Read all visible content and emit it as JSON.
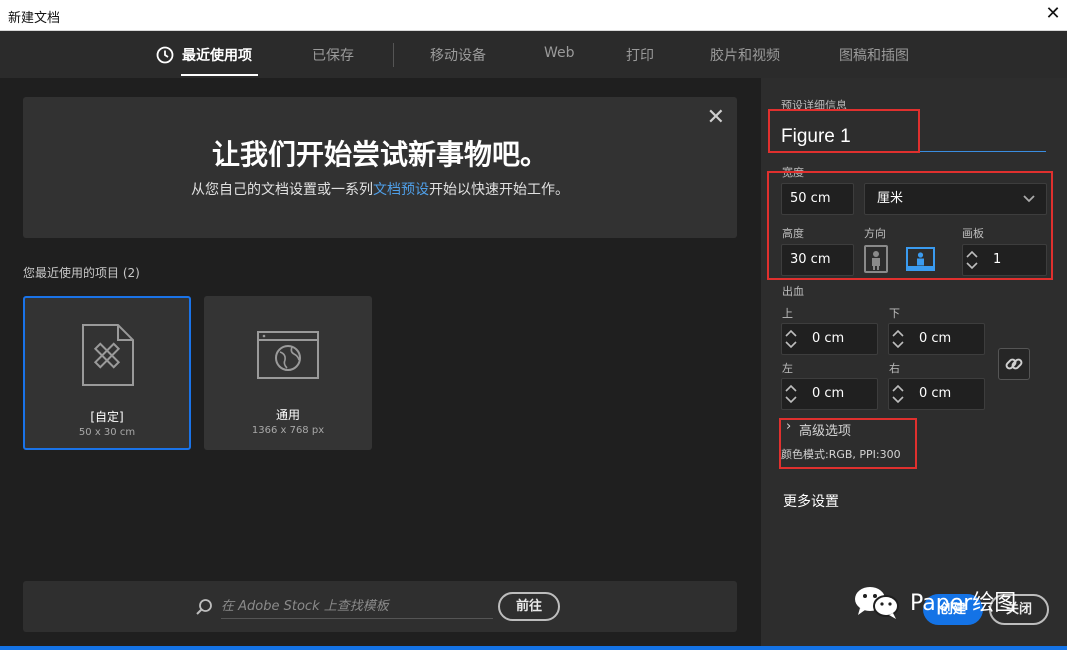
{
  "window": {
    "title": "新建文档",
    "close": "✕"
  },
  "tabs": [
    {
      "label": "最近使用项",
      "active": true
    },
    {
      "label": "已保存"
    },
    {
      "label": "移动设备"
    },
    {
      "label": "Web"
    },
    {
      "label": "打印"
    },
    {
      "label": "胶片和视频"
    },
    {
      "label": "图稿和插图"
    }
  ],
  "welcome": {
    "close": "✕",
    "heading": "让我们开始尝试新事物吧。",
    "sub_before": "从您自己的文档设置或一系列",
    "sub_link": "文档预设",
    "sub_after": "开始以快速开始工作。"
  },
  "recent": {
    "label": "您最近使用的项目",
    "count": "(2)",
    "items": [
      {
        "name": "[自定]",
        "dims": "50 x 30 cm",
        "icon": "document-ruler-pencil-icon",
        "selected": true
      },
      {
        "name": "通用",
        "dims": "1366 x 768 px",
        "icon": "web-globe-icon"
      }
    ]
  },
  "search": {
    "placeholder": "在 Adobe Stock 上查找模板",
    "go": "前往"
  },
  "preset": {
    "section_label": "预设详细信息",
    "name": "Figure 1",
    "width_label": "宽度",
    "width": "50 cm",
    "unit": "厘米",
    "height_label": "高度",
    "height": "30 cm",
    "orientation_label": "方向",
    "orientation": "landscape",
    "artboard_label": "画板",
    "artboards": "1",
    "bleed_label": "出血",
    "bleed": {
      "top_label": "上",
      "top": "0 cm",
      "bottom_label": "下",
      "bottom": "0 cm",
      "left_label": "左",
      "left": "0 cm",
      "right_label": "右",
      "right": "0 cm"
    },
    "advanced": "高级选项",
    "color_mode": "颜色模式:RGB, PPI:300",
    "more_settings": "更多设置",
    "create": "创建",
    "close": "关闭"
  },
  "watermark": {
    "text": "Paper绘图"
  },
  "colors": {
    "accent": "#1473e6",
    "highlight": "#e0302e",
    "link": "#4f9fe8"
  }
}
